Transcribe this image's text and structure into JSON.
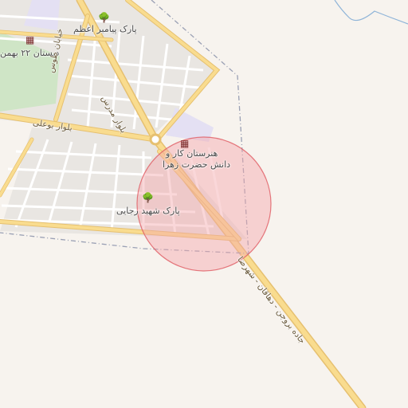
{
  "map": {
    "colors": {
      "background": "#f7f3ee",
      "block": "#e9e6e2",
      "street": "#ffffff",
      "main_road": "#f9dc8f",
      "main_road_edge": "#e6c070",
      "park": "#cfe5c6",
      "school_area": "#e4e0f3",
      "boundary": "#9aa0b4",
      "river": "#8fb4d8",
      "circle_fill": "#f4a6aa",
      "circle_stroke": "#e05a62"
    },
    "labels": {
      "park_payambar": "پارک پیامبر اعظم",
      "school_22bahman": "دبستان ۲۲ بهمن",
      "blvd_toos": "خیابان طوس",
      "blvd_modarres": "بلوار مدرس",
      "blvd_bouali": "بلوار بوعلی",
      "school_zahra_line1": "هنرستان کار و",
      "school_zahra_line2": "دانش حضرت زهرا",
      "park_rajaei": "پارک شهید رجایی",
      "road_shahreza": "جاده بروجن - دهاقان - شهرضا"
    },
    "icons": {
      "park": "tree-icon",
      "school": "school-icon"
    }
  }
}
